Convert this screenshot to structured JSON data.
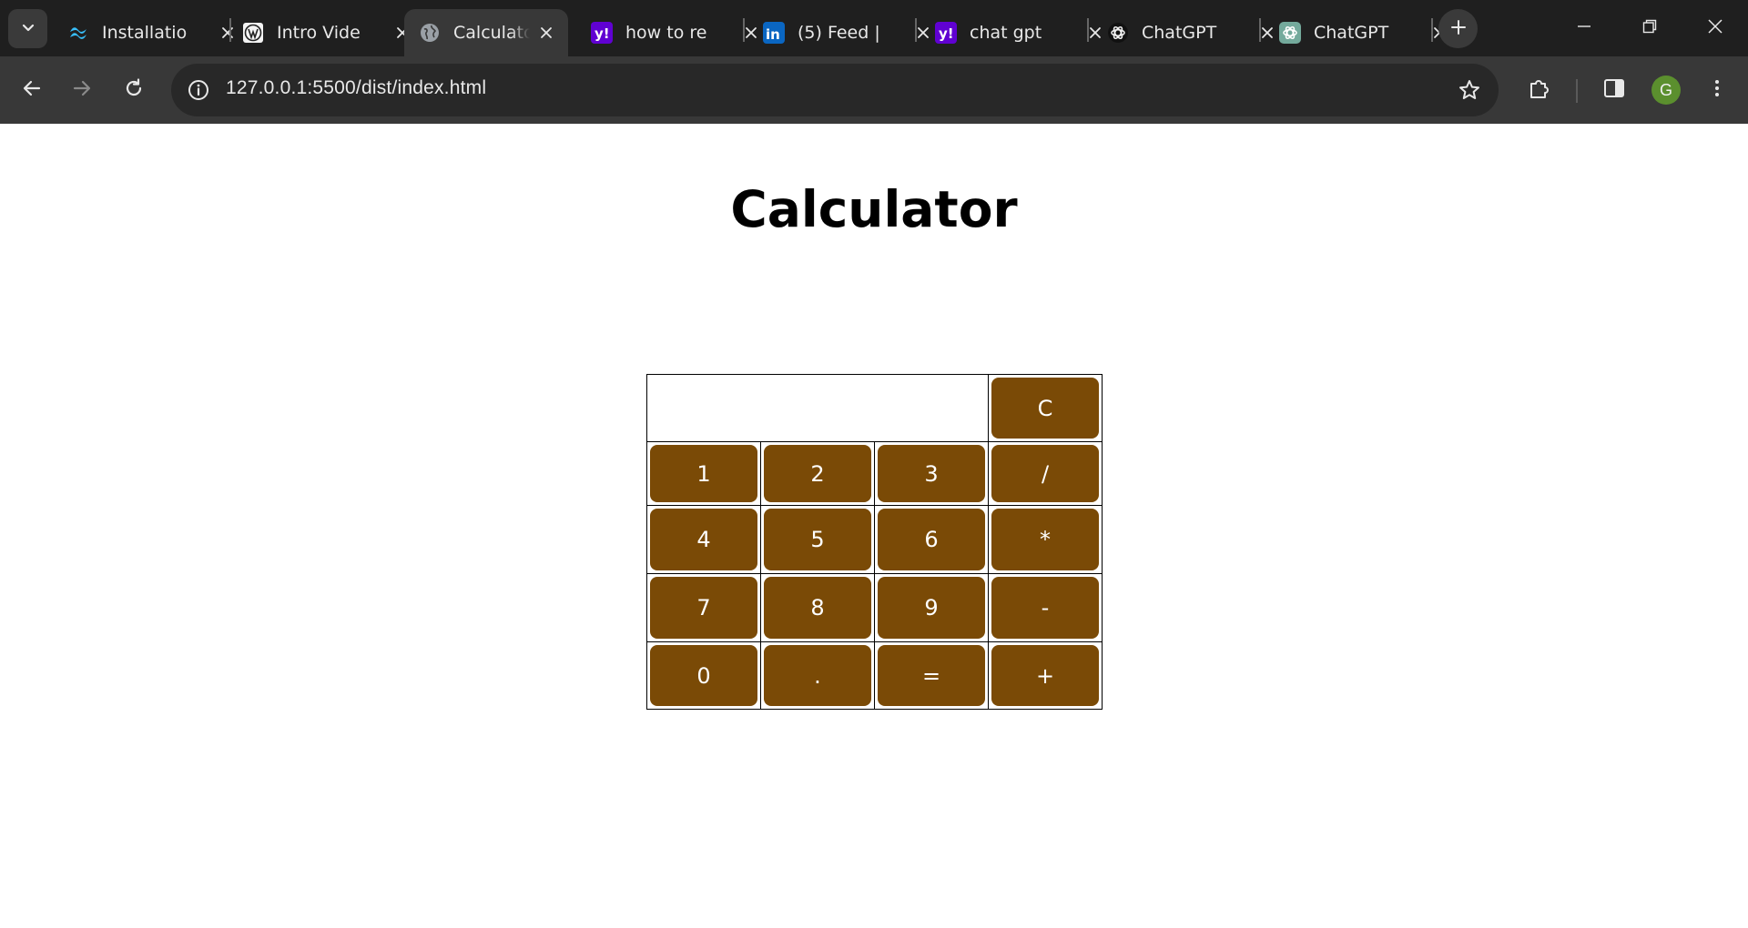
{
  "browser": {
    "colors": {
      "tabstrip_bg": "#1f1f1f",
      "active_tab_bg": "#383838",
      "toolbar_bg": "#383838"
    },
    "tabs": [
      {
        "title": "Installatio",
        "icon": "tailwind-icon",
        "active": false
      },
      {
        "title": "Intro Vide",
        "icon": "wordpress-icon",
        "active": false
      },
      {
        "title": "Calculato",
        "icon": "globe-icon",
        "active": true
      },
      {
        "title": "how to re",
        "icon": "yahoo-icon",
        "active": false
      },
      {
        "title": "(5) Feed |",
        "icon": "linkedin-icon",
        "active": false
      },
      {
        "title": "chat gpt",
        "icon": "yahoo-icon",
        "active": false
      },
      {
        "title": "ChatGPT",
        "icon": "openai-icon",
        "active": false
      },
      {
        "title": "ChatGPT",
        "icon": "openai-icon",
        "active": false
      }
    ],
    "address_bar": {
      "url": "127.0.0.1:5500/dist/index.html"
    },
    "profile": {
      "initial": "G",
      "color": "#5b8f2e"
    }
  },
  "page": {
    "title": "Calculator",
    "display_value": "",
    "key_color": "#7a4a06",
    "keys": {
      "clear": "C",
      "one": "1",
      "two": "2",
      "three": "3",
      "divide": "/",
      "four": "4",
      "five": "5",
      "six": "6",
      "multiply": "*",
      "seven": "7",
      "eight": "8",
      "nine": "9",
      "subtract": "-",
      "zero": "0",
      "decimal": ".",
      "equals": "=",
      "add": "+"
    }
  }
}
